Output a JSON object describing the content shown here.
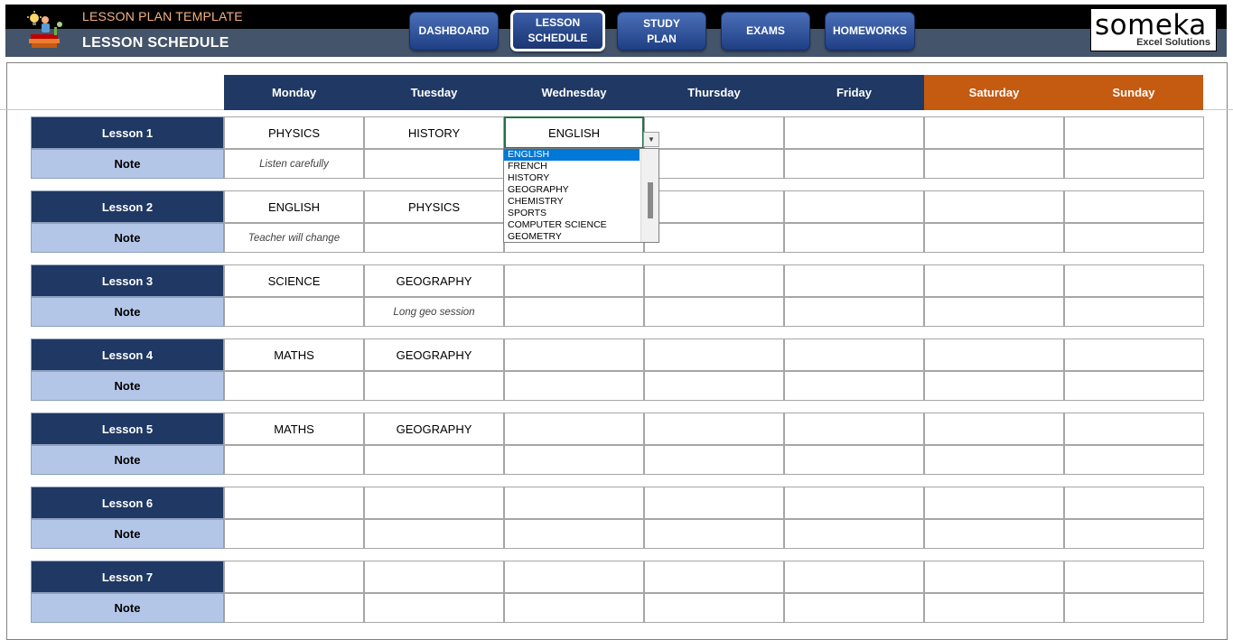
{
  "header": {
    "title": "LESSON PLAN TEMPLATE",
    "subtitle": "LESSON SCHEDULE",
    "logo_icon": "books-lightbulb-icon"
  },
  "nav": [
    {
      "label": "DASHBOARD",
      "active": false
    },
    {
      "label": "LESSON\nSCHEDULE",
      "active": true
    },
    {
      "label": "STUDY\nPLAN",
      "active": false
    },
    {
      "label": "EXAMS",
      "active": false
    },
    {
      "label": "HOMEWORKS",
      "active": false
    }
  ],
  "brand": {
    "name": "someka",
    "tagline": "Excel Solutions"
  },
  "colors": {
    "weekday_header": "#1f3864",
    "weekend_header": "#c55a11",
    "note_label": "#b4c6e7"
  },
  "days": [
    {
      "label": "Monday",
      "weekend": false
    },
    {
      "label": "Tuesday",
      "weekend": false
    },
    {
      "label": "Wednesday",
      "weekend": false
    },
    {
      "label": "Thursday",
      "weekend": false
    },
    {
      "label": "Friday",
      "weekend": false
    },
    {
      "label": "Saturday",
      "weekend": true
    },
    {
      "label": "Sunday",
      "weekend": true
    }
  ],
  "note_label": "Note",
  "lessons": [
    {
      "label": "Lesson 1",
      "subjects": [
        "PHYSICS",
        "HISTORY",
        "ENGLISH",
        "",
        "",
        "",
        ""
      ],
      "notes": [
        "Listen carefully",
        "",
        "",
        "",
        "",
        "",
        ""
      ]
    },
    {
      "label": "Lesson 2",
      "subjects": [
        "ENGLISH",
        "PHYSICS",
        "",
        "",
        "",
        "",
        ""
      ],
      "notes": [
        "Teacher will change",
        "",
        "",
        "",
        "",
        "",
        ""
      ]
    },
    {
      "label": "Lesson 3",
      "subjects": [
        "SCIENCE",
        "GEOGRAPHY",
        "",
        "",
        "",
        "",
        ""
      ],
      "notes": [
        "",
        "Long geo session",
        "",
        "",
        "",
        "",
        ""
      ]
    },
    {
      "label": "Lesson 4",
      "subjects": [
        "MATHS",
        "GEOGRAPHY",
        "",
        "",
        "",
        "",
        ""
      ],
      "notes": [
        "",
        "",
        "",
        "",
        "",
        "",
        ""
      ]
    },
    {
      "label": "Lesson 5",
      "subjects": [
        "MATHS",
        "GEOGRAPHY",
        "",
        "",
        "",
        "",
        ""
      ],
      "notes": [
        "",
        "",
        "",
        "",
        "",
        "",
        ""
      ]
    },
    {
      "label": "Lesson 6",
      "subjects": [
        "",
        "",
        "",
        "",
        "",
        "",
        ""
      ],
      "notes": [
        "",
        "",
        "",
        "",
        "",
        "",
        ""
      ]
    },
    {
      "label": "Lesson 7",
      "subjects": [
        "",
        "",
        "",
        "",
        "",
        "",
        ""
      ],
      "notes": [
        "",
        "",
        "",
        "",
        "",
        "",
        ""
      ]
    }
  ],
  "dropdown": {
    "options": [
      "ENGLISH",
      "FRENCH",
      "HISTORY",
      "GEOGRAPHY",
      "CHEMISTRY",
      "SPORTS",
      "COMPUTER SCIENCE",
      "GEOMETRY"
    ],
    "selected_index": 0
  }
}
